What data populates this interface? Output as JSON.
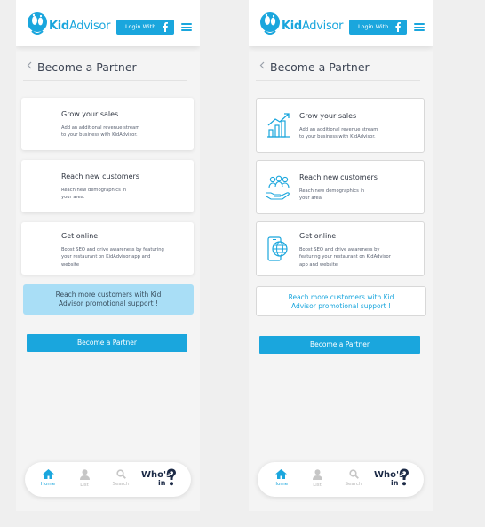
{
  "brand": {
    "name": "KidAdvisor",
    "name_main": "Kid",
    "name_sub": "Advisor",
    "accent": "#1aa6dd",
    "promo_bg": "#a9def6"
  },
  "header": {
    "login_label": "Login With"
  },
  "page": {
    "title": "Become a Partner"
  },
  "cards": [
    {
      "title": "Grow your sales",
      "desc_a": "Add an additional revenue stream",
      "desc_b": "to your business with KidAdvisor.",
      "icon": "growth-chart-icon"
    },
    {
      "title": "Reach new customers",
      "desc_a": "Reach new demographics in",
      "desc_b": "your area.",
      "icon": "customers-hand-icon"
    },
    {
      "title": "Get online",
      "desc_a": "Boost SEO and drive awareness by featuring",
      "desc_b": "your restaurant on KidAdvisor app and",
      "desc_c": "website",
      "desc_b_alt": "featuring your restaurant on KidAdvisor",
      "desc_a_alt": "Boost SEO and drive awareness by",
      "desc_c_alt": "app and website",
      "icon": "online-phone-globe-icon"
    }
  ],
  "promo": {
    "line1": "Reach more customers with Kid",
    "line2": "Advisor promotional support !"
  },
  "cta": {
    "label": "Become a Partner"
  },
  "nav": {
    "home": "Home",
    "list": "List",
    "search": "Search",
    "whos_line1": "Who's",
    "whos_line2": "in"
  }
}
